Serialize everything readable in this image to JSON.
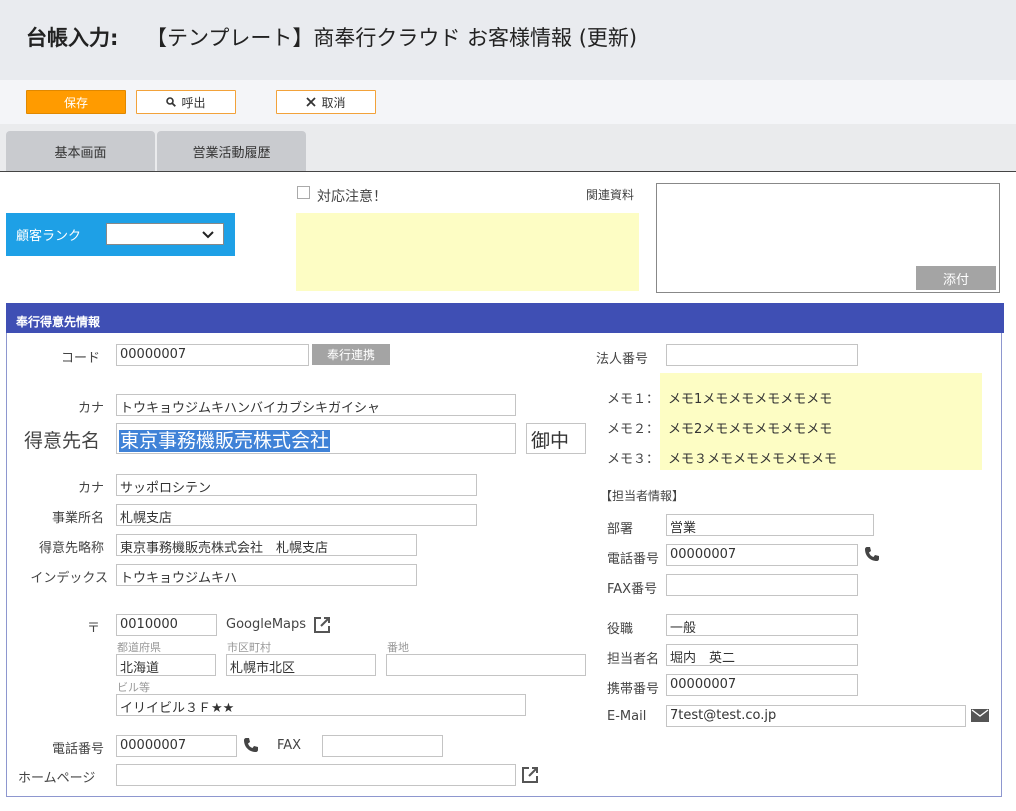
{
  "header": {
    "label": "台帳入力:",
    "title": "【テンプレート】商奉行クラウド お客様情報 (更新)"
  },
  "toolbar": {
    "save_label": "保存",
    "call_label": "呼出",
    "cancel_label": "取消"
  },
  "tabs": [
    {
      "label": "基本画面"
    },
    {
      "label": "営業活動履歴"
    }
  ],
  "rank": {
    "label": "顧客ランク",
    "value": ""
  },
  "attention": {
    "label": "対応注意！",
    "checked": false
  },
  "related": {
    "label": "関連資料",
    "attach_label": "添付"
  },
  "section": {
    "title": "奉行得意先情報"
  },
  "left": {
    "code_label": "コード",
    "code_value": "00000007",
    "bugyo_button": "奉行連携",
    "kana_label": "カナ",
    "kana_value": "トウキョウジムキハンバイカブシキガイシャ",
    "name_label": "得意先名",
    "name_value": "東京事務機販売株式会社",
    "honorific": "御中",
    "office_kana_label": "カナ",
    "office_kana_value": "サッポロシテン",
    "office_label": "事業所名",
    "office_value": "札幌支店",
    "short_label": "得意先略称",
    "short_value": "東京事務機販売株式会社　札幌支店",
    "index_label": "インデックス",
    "index_value": "トウキョウジムキハ",
    "zip_label": "〒",
    "zip_value": "0010000",
    "maps_label": "GoogleMaps",
    "pref_label": "都道府県",
    "pref_value": "北海道",
    "city_label": "市区町村",
    "city_value": "札幌市北区",
    "addr_label": "番地",
    "addr_value": "",
    "bldg_label": "ビル等",
    "bldg_value": "イリイビル３Ｆ★★",
    "tel_label": "電話番号",
    "tel_value": "00000007",
    "fax_label": "FAX",
    "fax_value": "",
    "hp_label": "ホームページ",
    "hp_value": ""
  },
  "right": {
    "corp_label": "法人番号",
    "corp_value": "",
    "memo1_label": "メモ１：",
    "memo1_value": "メモ1メモメモメモメモメモ",
    "memo2_label": "メモ２：",
    "memo2_value": "メモ2メモメモメモメモメモ",
    "memo3_label": "メモ３：",
    "memo3_value": "メモ３メモメモメモメモメモ",
    "contact_heading": "【担当者情報】",
    "dept_label": "部署",
    "dept_value": "営業",
    "tel_label": "電話番号",
    "tel_value": "00000007",
    "fax_label": "FAX番号",
    "fax_value": "",
    "role_label": "役職",
    "role_value": "一般",
    "person_label": "担当者名",
    "person_value": "堀内　英二",
    "mobile_label": "携帯番号",
    "mobile_value": "00000007",
    "email_label": "E-Mail",
    "email_value": "7test@test.co.jp"
  },
  "icons": {
    "phone": "phone-icon",
    "mail": "mail-icon",
    "external": "external-link-icon",
    "search": "search-icon",
    "close": "close-icon",
    "chevron": "chevron-down-icon"
  },
  "colors": {
    "accent_orange": "#ff9b00",
    "rank_blue": "#1ea0e6",
    "section_blue": "#3f4fb4",
    "memo_yellow": "#fdfdc4",
    "selection_blue": "#3f82d7"
  }
}
